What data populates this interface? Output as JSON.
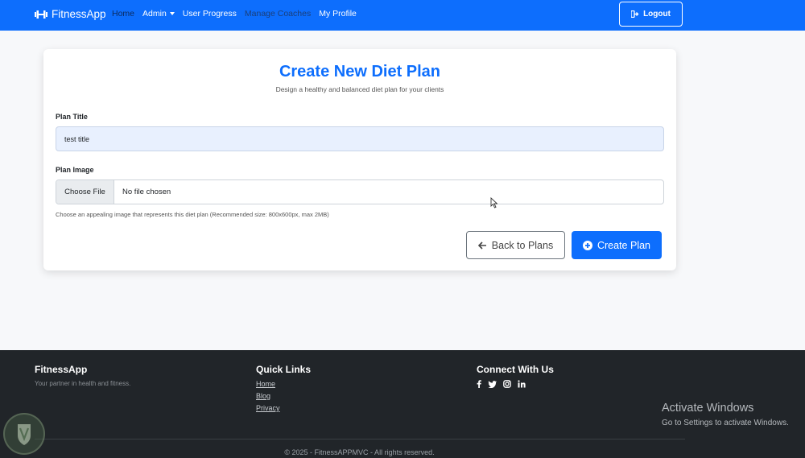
{
  "nav": {
    "brand": "FitnessApp",
    "links": [
      "Home",
      "Admin",
      "User Progress",
      "Manage Coaches",
      "My Profile"
    ],
    "logout": "Logout"
  },
  "form": {
    "title": "Create New Diet Plan",
    "subtitle": "Design a healthy and balanced diet plan for your clients",
    "plan_title_label": "Plan Title",
    "plan_title_value": "test title",
    "plan_image_label": "Plan Image",
    "file_button": "Choose File",
    "file_status": "No file chosen",
    "help": "Choose an appealing image that represents this diet plan (Recommended size: 800x600px, max 2MB)",
    "back_button": "Back to Plans",
    "create_button": "Create Plan"
  },
  "footer": {
    "brand": "FitnessApp",
    "tagline": "Your partner in health and fitness.",
    "quick_links_title": "Quick Links",
    "quick_links": [
      "Home",
      "Blog",
      "Privacy"
    ],
    "connect_title": "Connect With Us",
    "social_icons": [
      "facebook-icon",
      "twitter-icon",
      "instagram-icon",
      "linkedin-icon"
    ],
    "copyright": "© 2025 - FitnessAPPMVC - All rights reserved."
  },
  "overlay": {
    "activate_title": "Activate Windows",
    "activate_sub": "Go to Settings to activate Windows."
  },
  "colors": {
    "primary": "#0d6efd",
    "footer_bg": "#212529",
    "input_bg": "#e8f0fe"
  }
}
